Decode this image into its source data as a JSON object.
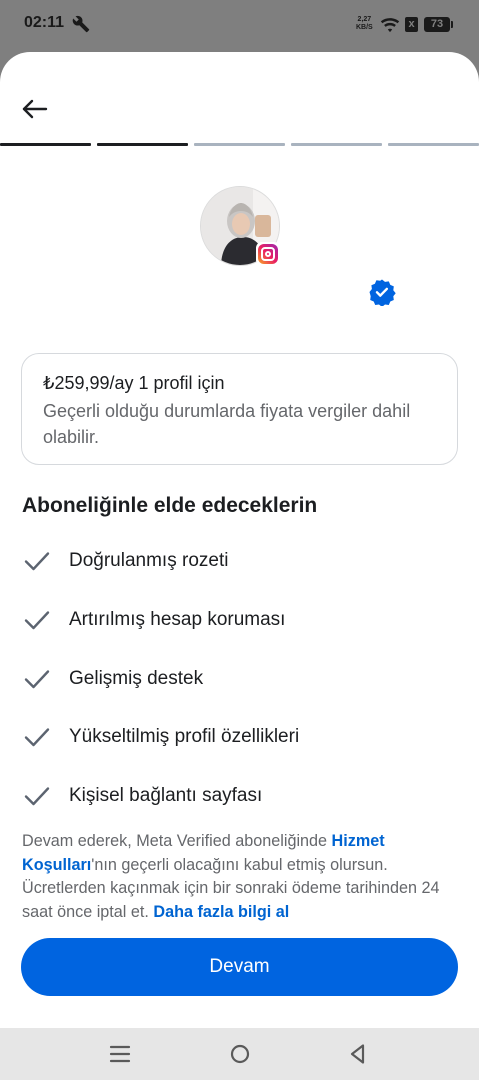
{
  "status_bar": {
    "time": "02:11",
    "net_speed_value": "2,27",
    "net_speed_unit": "KB/S",
    "sim_label": "x",
    "battery": "73"
  },
  "progress": {
    "total_steps": 5,
    "completed_steps": 2,
    "active_color": "#1c1e21",
    "inactive_color": "#a9b3bf"
  },
  "profile": {
    "avatar_alt": "profile photo",
    "badge_icon": "instagram-icon",
    "verified_icon": "verified-badge-icon",
    "verified_color": "#0064e0"
  },
  "price_card": {
    "title": "₺259,99/ay 1 profil için",
    "subtitle": "Geçerli olduğu durumlarda fiyata vergiler dahil olabilir."
  },
  "benefits": {
    "heading": "Aboneliğinle elde edeceklerin",
    "items": [
      "Doğrulanmış rozeti",
      "Artırılmış hesap koruması",
      "Gelişmiş destek",
      "Yükseltilmiş profil özellikleri",
      "Kişisel bağlantı sayfası"
    ]
  },
  "legal": {
    "text_1": "Devam ederek, Meta Verified aboneliğinde ",
    "link_terms": "Hizmet Koşulları",
    "text_2": "'nın geçerli olacağını kabul etmiş olursun. Ücretlerden kaçınmak için bir sonraki ödeme tarihinden 24 saat önce iptal et. ",
    "link_more": "Daha fazla bilgi al"
  },
  "continue_button": {
    "label": "Devam",
    "color": "#0064e0"
  },
  "nav_bar": {
    "menu_icon": "menu-icon",
    "home_icon": "home-circle-icon",
    "back_icon": "back-triangle-icon"
  }
}
